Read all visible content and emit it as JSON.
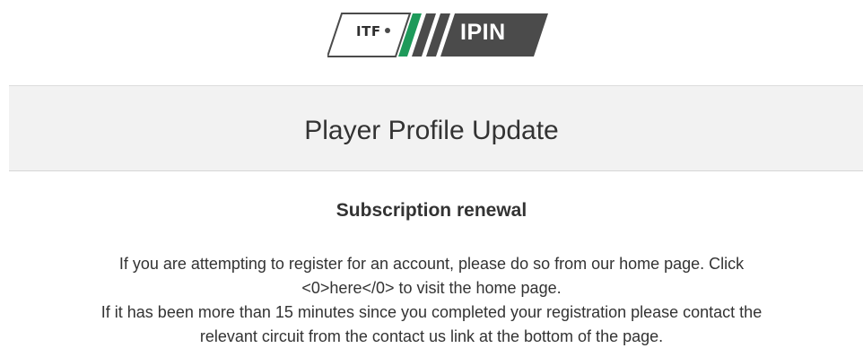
{
  "logo": {
    "left_text": "ITF",
    "right_text": "IPIN",
    "colors": {
      "dark": "#4b4b4b",
      "green": "#1e9a5a",
      "outline": "#4b4b4b"
    }
  },
  "header": {
    "title": "Player Profile Update"
  },
  "content": {
    "section_title": "Subscription renewal",
    "paragraph_1_line_1": "If you are attempting to register for an account, please do so from our home page. Click",
    "paragraph_1_line_2": "<0>here</0> to visit the home page.",
    "paragraph_2_line_1": "If it has been more than 15 minutes since you completed your registration please contact the",
    "paragraph_2_line_2": "relevant circuit from the contact us link at the bottom of the page."
  }
}
